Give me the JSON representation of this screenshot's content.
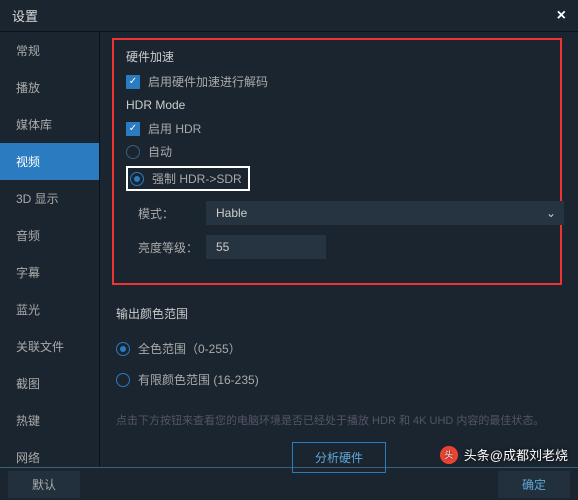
{
  "header": {
    "title": "设置"
  },
  "sidebar": {
    "items": [
      {
        "label": "常规"
      },
      {
        "label": "播放"
      },
      {
        "label": "媒体库"
      },
      {
        "label": "视频",
        "active": true
      },
      {
        "label": "3D 显示"
      },
      {
        "label": "音频"
      },
      {
        "label": "字幕"
      },
      {
        "label": "蓝光"
      },
      {
        "label": "关联文件"
      },
      {
        "label": "截图"
      },
      {
        "label": "热键"
      },
      {
        "label": "网络"
      }
    ]
  },
  "main": {
    "hwAccel": {
      "title": "硬件加速",
      "enable_hw_decode": "启用硬件加速进行解码"
    },
    "hdr": {
      "title": "HDR Mode",
      "enable": "启用 HDR",
      "auto": "自动",
      "force": "强制 HDR->SDR",
      "mode_label": "模式：",
      "mode_value": "Hable",
      "brightness_label": "亮度等级：",
      "brightness_value": "55"
    },
    "output": {
      "title": "输出颜色范围",
      "full": "全色范围（0-255）",
      "limited": "有限颜色范围 (16-235)"
    },
    "hint": "点击下方按钮来查看您的电脑环境是否已经处于播放 HDR 和 4K UHD 内容的最佳状态。",
    "analyze": "分析硬件"
  },
  "footer": {
    "default": "默认",
    "confirm": "确定"
  },
  "watermark": {
    "prefix": "头条",
    "handle": "@成都刘老烧"
  }
}
